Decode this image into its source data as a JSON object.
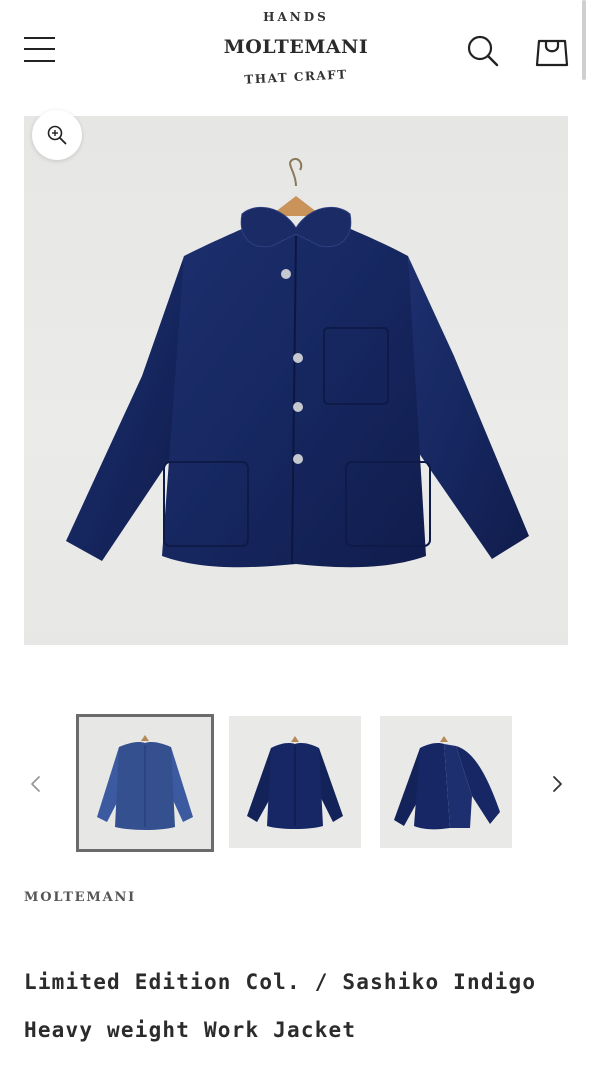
{
  "header": {
    "logo_top": "HANDS",
    "logo_main": "MOLTEMANI",
    "logo_bottom": "THAT CRAFT",
    "menu_icon": "hamburger-menu-icon",
    "search_icon": "search-icon",
    "cart_icon": "shopping-bag-icon"
  },
  "gallery": {
    "zoom_icon": "zoom-in-icon",
    "prev_icon": "chevron-left-icon",
    "next_icon": "chevron-right-icon",
    "selected_thumbnail": 1,
    "thumbnail_count_visible": 3
  },
  "product": {
    "vendor": "MOLTEMANI",
    "title": "Limited Edition Col. / Sashiko Indigo Heavy weight Work Jacket"
  },
  "colors": {
    "indigo": "#16265c",
    "background": "#ffffff",
    "photo_wall": "#e8e8e6",
    "selected_border": "#6b6b6b"
  }
}
